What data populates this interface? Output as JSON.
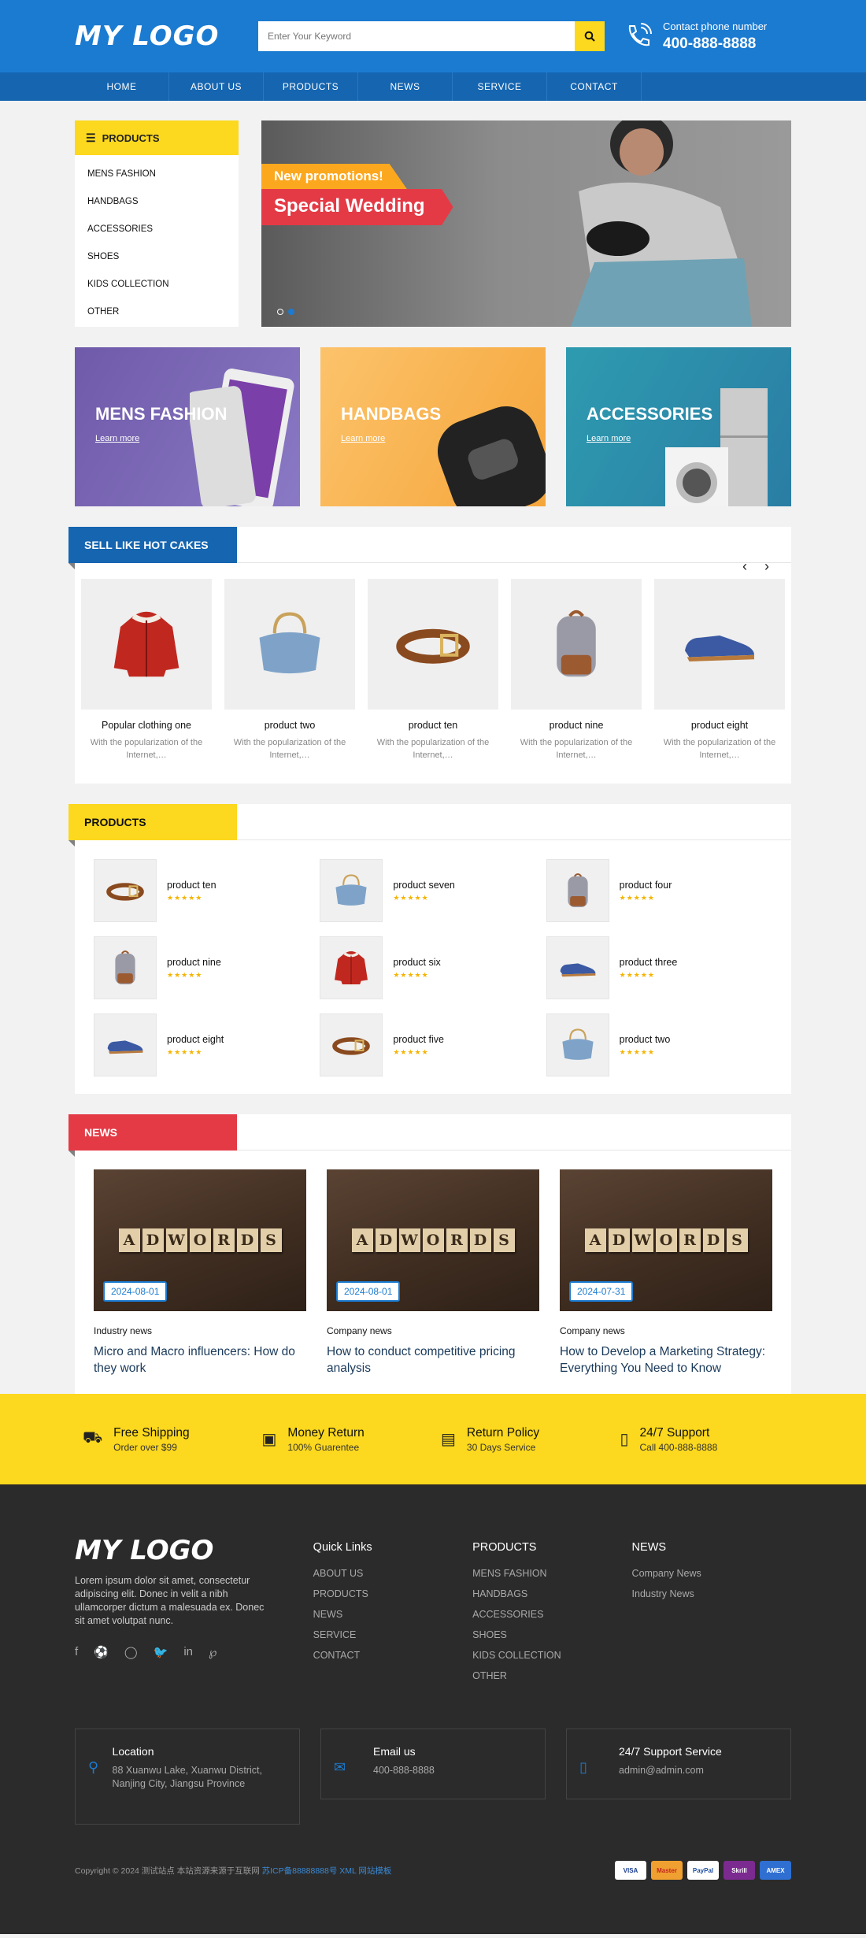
{
  "header": {
    "logo": "MY LOGO",
    "search_placeholder": "Enter Your Keyword",
    "phone_label": "Contact phone number",
    "phone_number": "400-888-8888"
  },
  "nav": [
    "HOME",
    "ABOUT US",
    "PRODUCTS",
    "NEWS",
    "SERVICE",
    "CONTACT"
  ],
  "categories": {
    "title": "PRODUCTS",
    "items": [
      "MENS FASHION",
      "HANDBAGS",
      "ACCESSORIES",
      "SHOES",
      "KIDS COLLECTION",
      "OTHER"
    ]
  },
  "banner": {
    "promo": "New promotions!",
    "title": "Special Wedding"
  },
  "promos": [
    {
      "title": "MENS FASHION",
      "link": "Learn more"
    },
    {
      "title": "HANDBAGS",
      "link": "Learn more"
    },
    {
      "title": "ACCESSORIES",
      "link": "Learn more"
    }
  ],
  "hot": {
    "title": "SELL LIKE HOT CAKES",
    "items": [
      {
        "name": "Popular clothing one",
        "desc": "With the popularization of the Internet,…",
        "icon": "jacket"
      },
      {
        "name": "product two",
        "desc": "With the popularization of the Internet,…",
        "icon": "bag"
      },
      {
        "name": "product ten",
        "desc": "With the popularization of the Internet,…",
        "icon": "belt"
      },
      {
        "name": "product nine",
        "desc": "With the popularization of the Internet,…",
        "icon": "backpack"
      },
      {
        "name": "product eight",
        "desc": "With the popularization of the Internet,…",
        "icon": "shoe"
      }
    ]
  },
  "products": {
    "title": "PRODUCTS",
    "stars": "★★★★★",
    "items": [
      {
        "name": "product ten",
        "icon": "belt"
      },
      {
        "name": "product seven",
        "icon": "bag"
      },
      {
        "name": "product four",
        "icon": "backpack"
      },
      {
        "name": "product nine",
        "icon": "backpack"
      },
      {
        "name": "product six",
        "icon": "jacket"
      },
      {
        "name": "product three",
        "icon": "shoe"
      },
      {
        "name": "product eight",
        "icon": "shoe"
      },
      {
        "name": "product five",
        "icon": "belt"
      },
      {
        "name": "product two",
        "icon": "bag"
      }
    ]
  },
  "news": {
    "title": "NEWS",
    "items": [
      {
        "date": "2024-08-01",
        "category": "Industry news",
        "title": "Micro and Macro influencers: How do they work"
      },
      {
        "date": "2024-08-01",
        "category": "Company news",
        "title": "How to conduct competitive pricing analysis"
      },
      {
        "date": "2024-07-31",
        "category": "Company news",
        "title": "How to Develop a Marketing Strategy: Everything You Need to Know"
      }
    ]
  },
  "news_tiles": [
    "A",
    "D",
    "W",
    "O",
    "R",
    "D",
    "S"
  ],
  "features": [
    {
      "title": "Free Shipping",
      "sub": "Order over $99",
      "icon": "truck-icon"
    },
    {
      "title": "Money Return",
      "sub": "100% Guarentee",
      "icon": "wallet-icon"
    },
    {
      "title": "Return Policy",
      "sub": "30 Days Service",
      "icon": "briefcase-icon"
    },
    {
      "title": "24/7 Support",
      "sub": "Call 400-888-8888",
      "icon": "mobile-icon"
    }
  ],
  "footer": {
    "logo": "MY LOGO",
    "desc": "Lorem ipsum dolor sit amet, consectetur adipiscing elit. Donec in velit a nibh ullamcorper dictum a malesuada ex. Donec sit amet volutpat nunc.",
    "quick_title": "Quick Links",
    "quick": [
      "ABOUT US",
      "PRODUCTS",
      "NEWS",
      "SERVICE",
      "CONTACT"
    ],
    "products_title": "PRODUCTS",
    "products": [
      "MENS FASHION",
      "HANDBAGS",
      "ACCESSORIES",
      "SHOES",
      "KIDS COLLECTION",
      "OTHER"
    ],
    "news_title": "NEWS",
    "news": [
      "Company News",
      "Industry News"
    ],
    "location_title": "Location",
    "location": "88 Xuanwu Lake, Xuanwu District, Nanjing City, Jiangsu Province",
    "email_title": "Email us",
    "email": "400-888-8888",
    "support_title": "24/7 Support Service",
    "support": "admin@admin.com",
    "copyright": "Copyright © 2024 测试站点 本站资源来源于互联网",
    "icp": "苏ICP备88888888号",
    "xml": "XML",
    "template": "网站模板",
    "payments": [
      "VISA",
      "Master",
      "PayPal",
      "Skrill",
      "AMEX"
    ]
  }
}
